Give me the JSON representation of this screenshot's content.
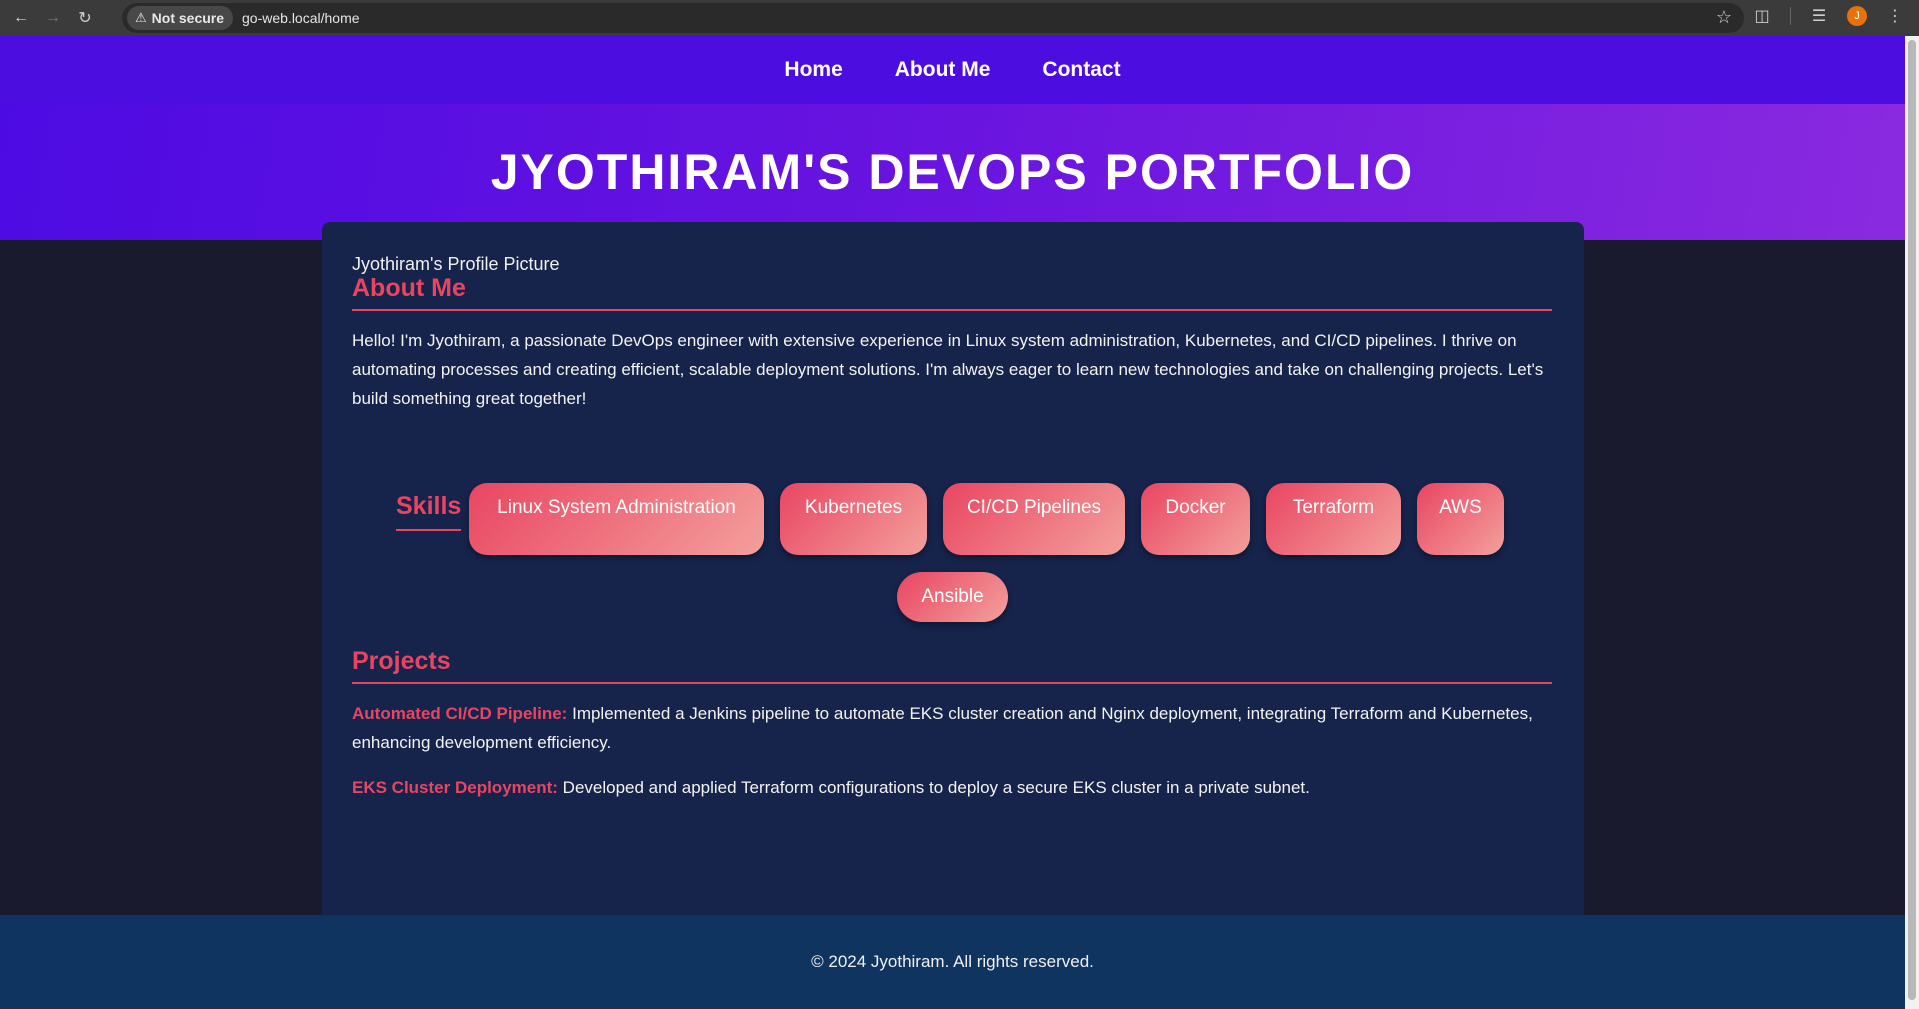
{
  "browser": {
    "security_label": "Not secure",
    "url": "go-web.local/home",
    "avatar_initial": "J"
  },
  "nav": {
    "items": [
      {
        "label": "Home"
      },
      {
        "label": "About Me"
      },
      {
        "label": "Contact"
      }
    ]
  },
  "hero": {
    "title": "JYOTHIRAM'S DEVOPS PORTFOLIO"
  },
  "profile": {
    "alt_text": "Jyothiram's Profile Picture"
  },
  "about": {
    "heading": "About Me",
    "text": "Hello! I'm Jyothiram, a passionate DevOps engineer with extensive experience in Linux system administration, Kubernetes, and CI/CD pipelines. I thrive on automating processes and creating efficient, scalable deployment solutions. I'm always eager to learn new technologies and take on challenging projects. Let's build something great together!"
  },
  "skills": {
    "heading": "Skills",
    "items": [
      "Linux System Administration",
      "Kubernetes",
      "CI/CD Pipelines",
      "Docker",
      "Terraform",
      "AWS",
      "Ansible"
    ]
  },
  "projects": {
    "heading": "Projects",
    "items": [
      {
        "title": "Automated CI/CD Pipeline:",
        "desc": "Implemented a Jenkins pipeline to automate EKS cluster creation and Nginx deployment, integrating Terraform and Kubernetes, enhancing development efficiency."
      },
      {
        "title": "EKS Cluster Deployment:",
        "desc": "Developed and applied Terraform configurations to deploy a secure EKS cluster in a private subnet."
      }
    ]
  },
  "footer": {
    "text": "© 2024 Jyothiram. All rights reserved."
  },
  "colors": {
    "nav_bg": "#4c0ee0",
    "accent": "#e94562",
    "card_bg": "#16234a",
    "page_bg": "#1a1a2e",
    "footer_bg": "#0f3460"
  }
}
